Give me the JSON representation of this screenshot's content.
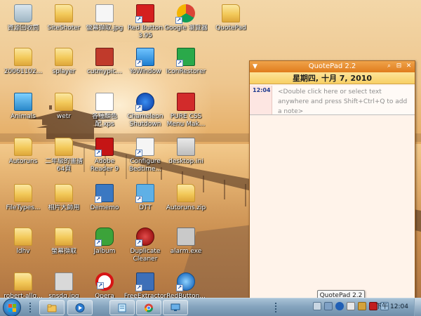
{
  "desktop_icons": [
    {
      "label": "資源回收筒"
    },
    {
      "label": "SiteShoter"
    },
    {
      "label": "螢幕擷取.jpg"
    },
    {
      "label": "Red Button 3.95"
    },
    {
      "label": "Google 瀏覽器"
    },
    {
      "label": "QuotePad"
    },
    {
      "label": "20061102..."
    },
    {
      "label": "splayer"
    },
    {
      "label": "cutmypic..."
    },
    {
      "label": "YoWindow"
    },
    {
      "label": "IconRestorer"
    },
    {
      "label": "Animals"
    },
    {
      "label": "wetr"
    },
    {
      "label": "各種顏色配.xps"
    },
    {
      "label": "Chameleon Shutdown"
    },
    {
      "label": "PURE CSS Menu Mak..."
    },
    {
      "label": "Autoruns"
    },
    {
      "label": "二年級的畫譜64頁"
    },
    {
      "label": "Adobe Reader 9"
    },
    {
      "label": "Configure Bedtime..."
    },
    {
      "label": "desktop.ini"
    },
    {
      "label": "FileTypes..."
    },
    {
      "label": "相片大師用"
    },
    {
      "label": "Dememo"
    },
    {
      "label": "DTT"
    },
    {
      "label": "Autoruns.zip"
    },
    {
      "label": "ldhv"
    },
    {
      "label": "螢幕擷取"
    },
    {
      "label": "Jalbum"
    },
    {
      "label": "Duplicate Cleaner"
    },
    {
      "label": "alarm.exe"
    },
    {
      "label": "robert-allg..."
    },
    {
      "label": "snsdg.jpg"
    },
    {
      "label": "Opera"
    },
    {
      "label": "FreeExtractor"
    },
    {
      "label": "RedButton..."
    }
  ],
  "quotepad": {
    "title": "QuotePad 2.2",
    "menu_icon": "▼",
    "date": "星期四, 十月 7, 2010",
    "note_time": "12:04",
    "note_placeholder": "<Double click here or select text anywhere and press Shift+Ctrl+Q to add a note>"
  },
  "tooltip": {
    "text": "QuotePad 2.2"
  },
  "taskbar": {
    "clock": "下午 12:04",
    "buttons": [
      "explorer",
      "media-player",
      "notepad",
      "chrome",
      "remote-desktop"
    ]
  },
  "colors": {
    "titlebar": "#e07c1d",
    "datebar": "#f7cf64",
    "note_time": "#1f3b8f"
  }
}
